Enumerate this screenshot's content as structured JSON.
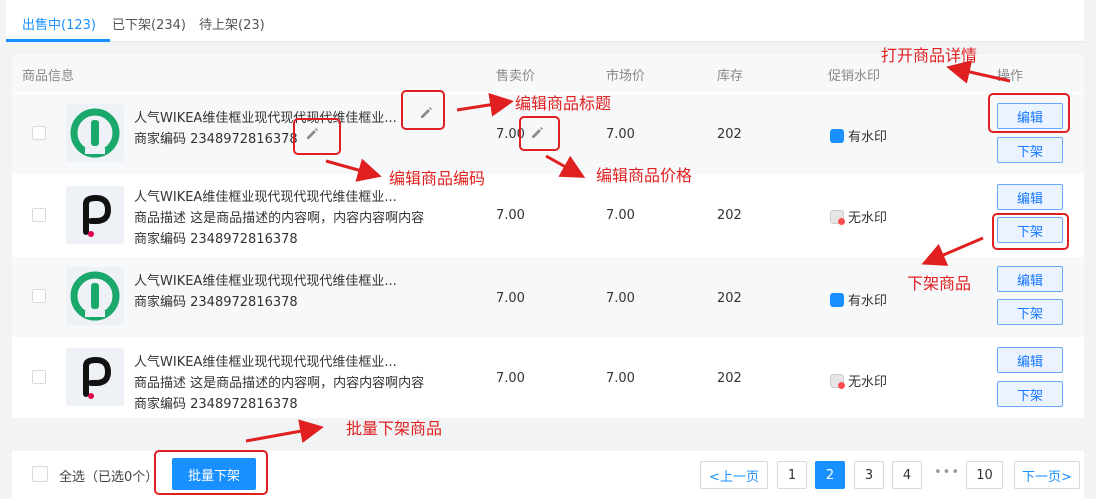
{
  "tabs": [
    {
      "label": "出售中(123)"
    },
    {
      "label": "已下架(234)"
    },
    {
      "label": "待上架(23)"
    }
  ],
  "table": {
    "headers": {
      "info": "商品信息",
      "price": "售卖价",
      "market_price": "市场价",
      "stock": "库存",
      "watermark": "促销水印",
      "actions": "操作"
    },
    "rows": [
      {
        "logo": "green-logo",
        "title": "人气WIKEA维佳框业现代现代现代维佳框业...",
        "desc": "",
        "code": "商家编码 2348972816378",
        "price": "7.00",
        "market_price": "7.00",
        "stock": "202",
        "watermark": "有水印",
        "edit": "编辑",
        "offshelf": "下架"
      },
      {
        "logo": "p-logo",
        "title": "人气WIKEA维佳框业现代现代现代维佳框业...",
        "desc": "商品描述 这是商品描述的内容啊，内容内容啊内容",
        "code": "商家编码 2348972816378",
        "price": "7.00",
        "market_price": "7.00",
        "stock": "202",
        "watermark": "无水印",
        "edit": "编辑",
        "offshelf": "下架"
      },
      {
        "logo": "green-logo",
        "title": "人气WIKEA维佳框业现代现代现代维佳框业...",
        "desc": "",
        "code": "商家编码 2348972816378",
        "price": "7.00",
        "market_price": "7.00",
        "stock": "202",
        "watermark": "有水印",
        "edit": "编辑",
        "offshelf": "下架"
      },
      {
        "logo": "p-logo",
        "title": "人气WIKEA维佳框业现代现代现代维佳框业...",
        "desc": "商品描述 这是商品描述的内容啊，内容内容啊内容",
        "code": "商家编码 2348972816378",
        "price": "7.00",
        "market_price": "7.00",
        "stock": "202",
        "watermark": "无水印",
        "edit": "编辑",
        "offshelf": "下架"
      }
    ]
  },
  "footer": {
    "select_all": "全选（已选0个）",
    "batch_offshelf": "批量下架",
    "pagination": {
      "prev": "<上一页",
      "pages": [
        "1",
        "2",
        "3",
        "4"
      ],
      "current": "2",
      "ellipsis": "•••",
      "last": "10",
      "next": "下一页>"
    }
  },
  "annotations": {
    "open_detail": "打开商品详情",
    "edit_title": "编辑商品标题",
    "edit_code": "编辑商品编码",
    "edit_price": "编辑商品价格",
    "offshelf_product": "下架商品",
    "batch_offshelf": "批量下架商品"
  },
  "colors": {
    "primary": "#1890ff",
    "annotation": "#e02020",
    "logo_green": "#1aa86b"
  }
}
